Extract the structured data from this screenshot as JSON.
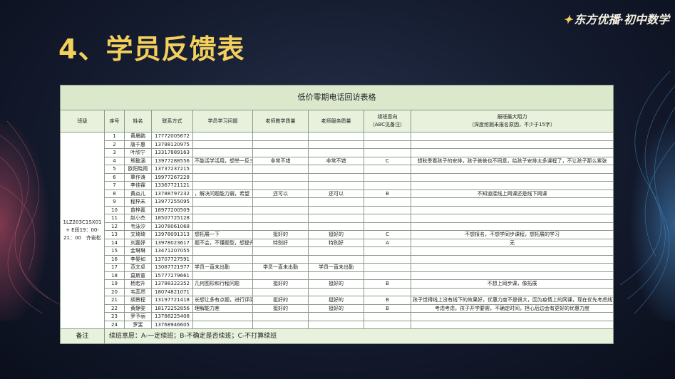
{
  "title": "4、学员反馈表",
  "brand": "东方优播·初中数学",
  "table": {
    "caption": "低价零期电话回访表格",
    "headers": {
      "class": "班级",
      "no": "序号",
      "name": "姓名",
      "contact": "联系方式",
      "learning_issue": "学员学习问题",
      "teach_quality": "老师教学质量",
      "service_quality": "老师服务质量",
      "intent_line1": "续班意向",
      "intent_line2": "（ABC见备注）",
      "obstacle_line1": "报班最大阻力",
      "obstacle_line2": "（深度挖掘未报名原因，不少于15字）"
    },
    "class_info": "1LZ203C1SX01 + E段19：00-21：00　齐岩松",
    "rows": [
      {
        "no": "1",
        "name": "黄晨鹏",
        "phone": "17772005672",
        "issue": "",
        "teach": "",
        "service": "",
        "intent": "",
        "obstacle": ""
      },
      {
        "no": "2",
        "name": "唐千惠",
        "phone": "13788120975",
        "issue": "",
        "teach": "",
        "service": "",
        "intent": "",
        "obstacle": ""
      },
      {
        "no": "3",
        "name": "叶欣宁",
        "phone": "13317889163",
        "issue": "",
        "teach": "",
        "service": "",
        "intent": "",
        "obstacle": ""
      },
      {
        "no": "4",
        "name": "熊懿涵",
        "phone": "13977288556",
        "issue": "不能活学活用，想举一反三",
        "teach": "非常不错",
        "service": "非常不错",
        "intent": "C",
        "obstacle": "想秋季看孩子的安排，孩子爸爸也不同意，给孩子安排太多课程了，不让孩子那么累张"
      },
      {
        "no": "5",
        "name": "欧阳晓雨",
        "phone": "13737237215",
        "issue": "",
        "teach": "",
        "service": "",
        "intent": "",
        "obstacle": ""
      },
      {
        "no": "6",
        "name": "覃作涛",
        "phone": "19977267228",
        "issue": "",
        "teach": "",
        "service": "",
        "intent": "",
        "obstacle": ""
      },
      {
        "no": "7",
        "name": "李佳霖",
        "phone": "13367721121",
        "issue": "",
        "teach": "",
        "service": "",
        "intent": "",
        "obstacle": ""
      },
      {
        "no": "8",
        "name": "黄焱儿",
        "phone": "13788797232",
        "issue": "，解决问题能力弱，希望",
        "teach": "还可以",
        "service": "还可以",
        "intent": "B",
        "obstacle": "不知道接线上网课还是线下网课"
      },
      {
        "no": "9",
        "name": "程梓未",
        "phone": "13977255095",
        "issue": "",
        "teach": "",
        "service": "",
        "intent": "",
        "obstacle": ""
      },
      {
        "no": "10",
        "name": "曾梓嘉",
        "phone": "18977200509",
        "issue": "",
        "teach": "",
        "service": "",
        "intent": "",
        "obstacle": ""
      },
      {
        "no": "11",
        "name": "赵小杰",
        "phone": "18507725128",
        "issue": "",
        "teach": "",
        "service": "",
        "intent": "",
        "obstacle": ""
      },
      {
        "no": "12",
        "name": "韦泳汐",
        "phone": "13078061068",
        "issue": "",
        "teach": "",
        "service": "",
        "intent": "",
        "obstacle": ""
      },
      {
        "no": "13",
        "name": "文琦琦",
        "phone": "13978091313",
        "issue": "想拓展一下",
        "teach": "挺好的",
        "service": "挺好的",
        "intent": "C",
        "obstacle": "不想报名，不想学同步课程，想拓展的学习"
      },
      {
        "no": "14",
        "name": "刘嘉妤",
        "phone": "13978023617",
        "issue": "题不会，不懂题型，想提升",
        "teach": "特别好",
        "service": "特别好",
        "intent": "A",
        "obstacle": "无"
      },
      {
        "no": "15",
        "name": "金琳琳",
        "phone": "13471207055",
        "issue": "",
        "teach": "",
        "service": "",
        "intent": "",
        "obstacle": ""
      },
      {
        "no": "16",
        "name": "李晏如",
        "phone": "13707727591",
        "issue": "",
        "teach": "",
        "service": "",
        "intent": "",
        "obstacle": ""
      },
      {
        "no": "17",
        "name": "范文卓",
        "phone": "13087721977",
        "issue": "学员一直未出勤",
        "teach": "学员一直未出勤",
        "service": "学员一直未出勤",
        "intent": "",
        "obstacle": ""
      },
      {
        "no": "18",
        "name": "莫斯童",
        "phone": "15777279661",
        "issue": "",
        "teach": "",
        "service": "",
        "intent": "",
        "obstacle": ""
      },
      {
        "no": "19",
        "name": "杨宏升",
        "phone": "13788322352",
        "issue": "几何图形和行程问题",
        "teach": "挺好的",
        "service": "挺好的",
        "intent": "B",
        "obstacle": "不想上同步课，像拓展"
      },
      {
        "no": "20",
        "name": "韦蕊然",
        "phone": "18074821071",
        "issue": "",
        "teach": "",
        "service": "",
        "intent": "",
        "obstacle": ""
      },
      {
        "no": "21",
        "name": "胡景程",
        "phone": "13197721418",
        "issue": "长想让多有点题，进行评阅难",
        "teach": "挺好的",
        "service": "挺好的",
        "intent": "B",
        "obstacle": "孩子觉得线上没有线下的效果好，优惠力度不是很大，因为疫情上的网课，现在优先考虑线下"
      },
      {
        "no": "22",
        "name": "黄静雯",
        "phone": "18172252856",
        "issue": "理解能力差",
        "teach": "挺好的",
        "service": "挺好的",
        "intent": "B",
        "obstacle": "考虑考虑，孩子开学要需，不确定时间，担心后边会有更好的优惠力度"
      },
      {
        "no": "23",
        "name": "罗予丽",
        "phone": "13788225408",
        "issue": "",
        "teach": "",
        "service": "",
        "intent": "",
        "obstacle": ""
      },
      {
        "no": "24",
        "name": "罗斐",
        "phone": "13768946605",
        "issue": "",
        "teach": "",
        "service": "",
        "intent": "",
        "obstacle": ""
      }
    ],
    "note_label": "备注",
    "note_text": "续班意愿：A-一定续班；B-不确定是否续班；C-不打算续班"
  }
}
